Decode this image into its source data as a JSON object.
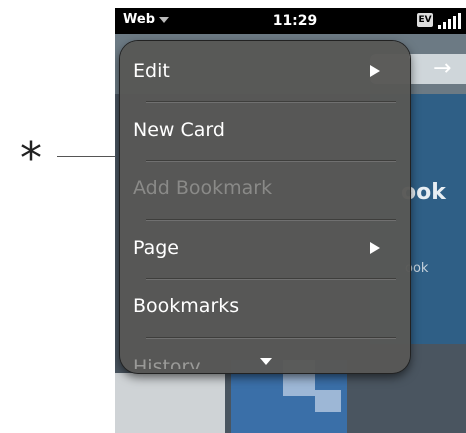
{
  "annotation": {
    "marker": "*"
  },
  "statusbar": {
    "app_menu_label": "Web",
    "time": "11:29",
    "network": "EV"
  },
  "background": {
    "text_fragment_1": "ook",
    "text_fragment_2": "ook"
  },
  "menu": {
    "items": [
      {
        "label": "Edit",
        "has_submenu": true,
        "enabled": true
      },
      {
        "label": "New Card",
        "has_submenu": false,
        "enabled": true
      },
      {
        "label": "Add Bookmark",
        "has_submenu": false,
        "enabled": false
      },
      {
        "label": "Page",
        "has_submenu": true,
        "enabled": true
      },
      {
        "label": "Bookmarks",
        "has_submenu": false,
        "enabled": true
      },
      {
        "label": "History",
        "has_submenu": false,
        "enabled": true
      }
    ]
  }
}
